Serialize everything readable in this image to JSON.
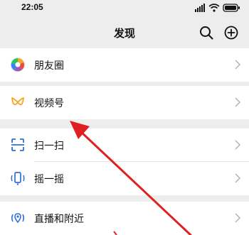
{
  "status_bar": {
    "time": "22:05",
    "icons": [
      "signal-icon",
      "wifi-icon",
      "battery-icon"
    ]
  },
  "nav": {
    "title": "发现",
    "search_icon": "search-icon",
    "add_icon": "add-circle-icon"
  },
  "items": [
    {
      "label": "朋友圈",
      "icon": "moments-icon"
    },
    {
      "label": "视频号",
      "icon": "channels-icon"
    },
    {
      "label": "扫一扫",
      "icon": "scan-icon"
    },
    {
      "label": "摇一摇",
      "icon": "shake-icon"
    },
    {
      "label": "直播和附近",
      "icon": "live-nearby-icon"
    }
  ],
  "colors": {
    "background": "#ededed",
    "cell": "#ffffff",
    "annotation_arrow": "#e02020",
    "channels_accent": "#f5a623",
    "scan_accent": "#2f6fd6"
  }
}
